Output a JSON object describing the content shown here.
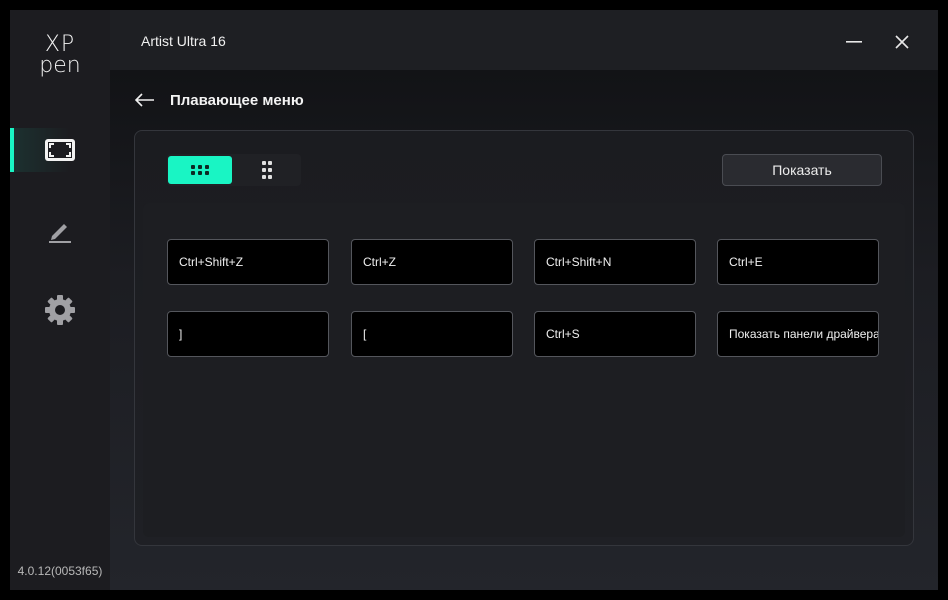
{
  "app": {
    "logo_line1": "XP",
    "logo_line2": "pen",
    "version": "4.0.12(0053f65)",
    "accent_color": "#19f5c4"
  },
  "titlebar": {
    "title": "Artist Ultra 16",
    "minimize_icon": "minimize-icon",
    "close_icon": "close-icon"
  },
  "sidebar": {
    "items": [
      {
        "icon": "screen-area-icon",
        "active": true
      },
      {
        "icon": "pen-icon",
        "active": false
      },
      {
        "icon": "gear-icon",
        "active": false
      }
    ]
  },
  "page": {
    "back_icon": "back-arrow-icon",
    "title": "Плавающее меню"
  },
  "toolbar": {
    "view_grid_icon": "grid-layout-icon",
    "view_compact_icon": "compact-layout-icon",
    "show_label": "Показать"
  },
  "keys": [
    "Ctrl+Shift+Z",
    "Ctrl+Z",
    "Ctrl+Shift+N",
    "Ctrl+E",
    "]",
    "[",
    "Ctrl+S",
    "Показать панели драйвера"
  ]
}
